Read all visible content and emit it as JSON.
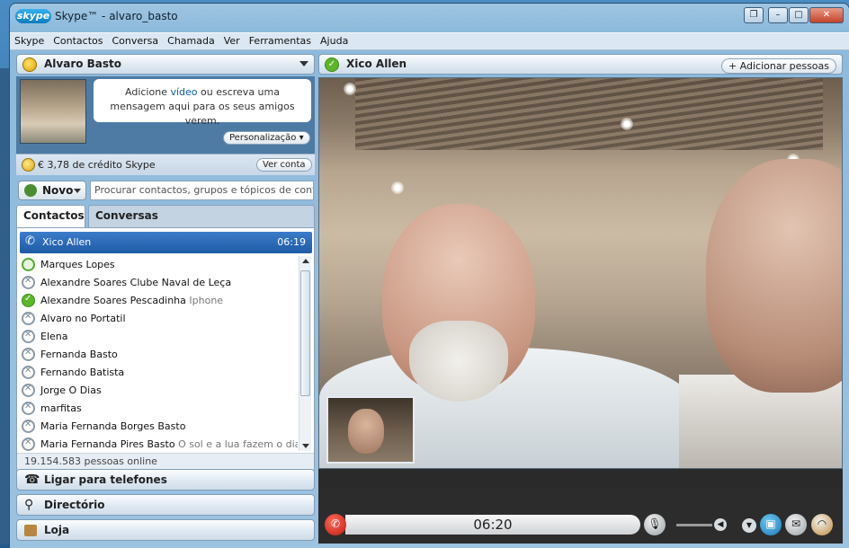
{
  "window": {
    "logo": "skype",
    "title": "Skype™ - alvaro_basto",
    "controls": [
      "❐",
      "–",
      "□",
      "✕"
    ]
  },
  "menu": [
    "Skype",
    "Contactos",
    "Conversa",
    "Chamada",
    "Ver",
    "Ferramentas",
    "Ajuda"
  ],
  "profile": {
    "name": "Alvaro Basto",
    "bubble_pre": "Adicione ",
    "bubble_link": "vídeo",
    "bubble_post": " ou escreva uma mensagem aqui para os seus amigos verem.",
    "personalize_label": "Personalização ▾",
    "credit_text": "€ 3,78 de crédito Skype",
    "view_account_label": "Ver conta"
  },
  "toolbar": {
    "new_label": "Novo",
    "search_placeholder": "Procurar contactos, grupos e tópicos de conve..."
  },
  "tabs": {
    "contacts": "Contactos",
    "conversations": "Conversas"
  },
  "active_call": {
    "name": "Xico Allen",
    "time": "06:19"
  },
  "contacts": [
    {
      "name": "Marques Lopes",
      "mood": "",
      "status": "phone"
    },
    {
      "name": "Alexandre Soares Clube Naval de Leça",
      "mood": "",
      "status": "offline"
    },
    {
      "name": "Alexandre Soares Pescadinha",
      "mood": "Iphone",
      "status": "online"
    },
    {
      "name": "Alvaro no Portatil",
      "mood": "",
      "status": "offline"
    },
    {
      "name": "Elena",
      "mood": "",
      "status": "offline"
    },
    {
      "name": "Fernanda Basto",
      "mood": "",
      "status": "offline"
    },
    {
      "name": "Fernando Batista",
      "mood": "",
      "status": "offline"
    },
    {
      "name": "Jorge O Dias",
      "mood": "",
      "status": "offline"
    },
    {
      "name": "marfitas",
      "mood": "",
      "status": "offline"
    },
    {
      "name": "Maria Fernanda Borges Basto",
      "mood": "",
      "status": "offline"
    },
    {
      "name": "Maria Fernanda Pires Basto",
      "mood": "O sol e a lua fazem o dia...",
      "status": "offline"
    }
  ],
  "online_count": "19.154.583 pessoas online",
  "sections": {
    "phones": "Ligar para telefones",
    "directory": "Directório",
    "shop": "Loja"
  },
  "conversation": {
    "title": "Xico Allen",
    "add_people": "+ Adicionar pessoas",
    "call_time": "06:20"
  },
  "colors": {
    "accent": "#1e5aa6",
    "online": "#5cb62a",
    "hangup": "#c11a10"
  }
}
